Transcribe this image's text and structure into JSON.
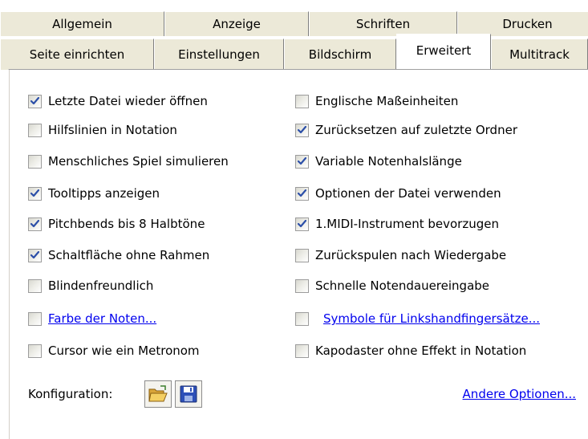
{
  "tabs_row1": [
    "Allgemein",
    "Anzeige",
    "Schriften",
    "Drucken"
  ],
  "tabs_row2": [
    "Seite einrichten",
    "Einstellungen",
    "Bildschirm",
    "Erweitert",
    "Multitrack"
  ],
  "active_tab": "Erweitert",
  "left_options": [
    {
      "label": "Letzte Datei wieder öffnen",
      "checked": true,
      "link": false
    },
    {
      "label": "Hilfslinien in Notation",
      "checked": false,
      "link": false
    },
    {
      "label": "Menschliches Spiel simulieren",
      "checked": false,
      "link": false
    },
    {
      "label": "Tooltipps anzeigen",
      "checked": true,
      "link": false
    },
    {
      "label": "Pitchbends bis 8 Halbtöne",
      "checked": true,
      "link": false
    },
    {
      "label": "Schaltfläche ohne Rahmen",
      "checked": true,
      "link": false
    },
    {
      "label": "Blindenfreundlich",
      "checked": false,
      "link": false
    },
    {
      "label": "Farbe der Noten...",
      "checked": false,
      "link": true
    },
    {
      "label": "Cursor wie ein Metronom",
      "checked": false,
      "link": false
    }
  ],
  "right_options": [
    {
      "label": "Englische Maßeinheiten",
      "checked": false,
      "link": false
    },
    {
      "label": "Zurücksetzen auf zuletzte Ordner",
      "checked": true,
      "link": false
    },
    {
      "label": "Variable Notenhalslänge",
      "checked": true,
      "link": false
    },
    {
      "label": "Optionen der Datei verwenden",
      "checked": true,
      "link": false
    },
    {
      "label": "1.MIDI-Instrument bevorzugen",
      "checked": true,
      "link": false
    },
    {
      "label": "Zurückspulen nach Wiedergabe",
      "checked": false,
      "link": false
    },
    {
      "label": "Schnelle Notendauereingabe",
      "checked": false,
      "link": false
    },
    {
      "label": "Symbole für Linkshandfingersätze...",
      "checked": false,
      "link": true
    },
    {
      "label": "Kapodaster ohne Effekt in Notation",
      "checked": false,
      "link": false
    }
  ],
  "config_label": "Konfiguration:",
  "other_options_link": "Andere Optionen...",
  "icons": {
    "open": "folder-open-icon",
    "save": "floppy-save-icon"
  }
}
